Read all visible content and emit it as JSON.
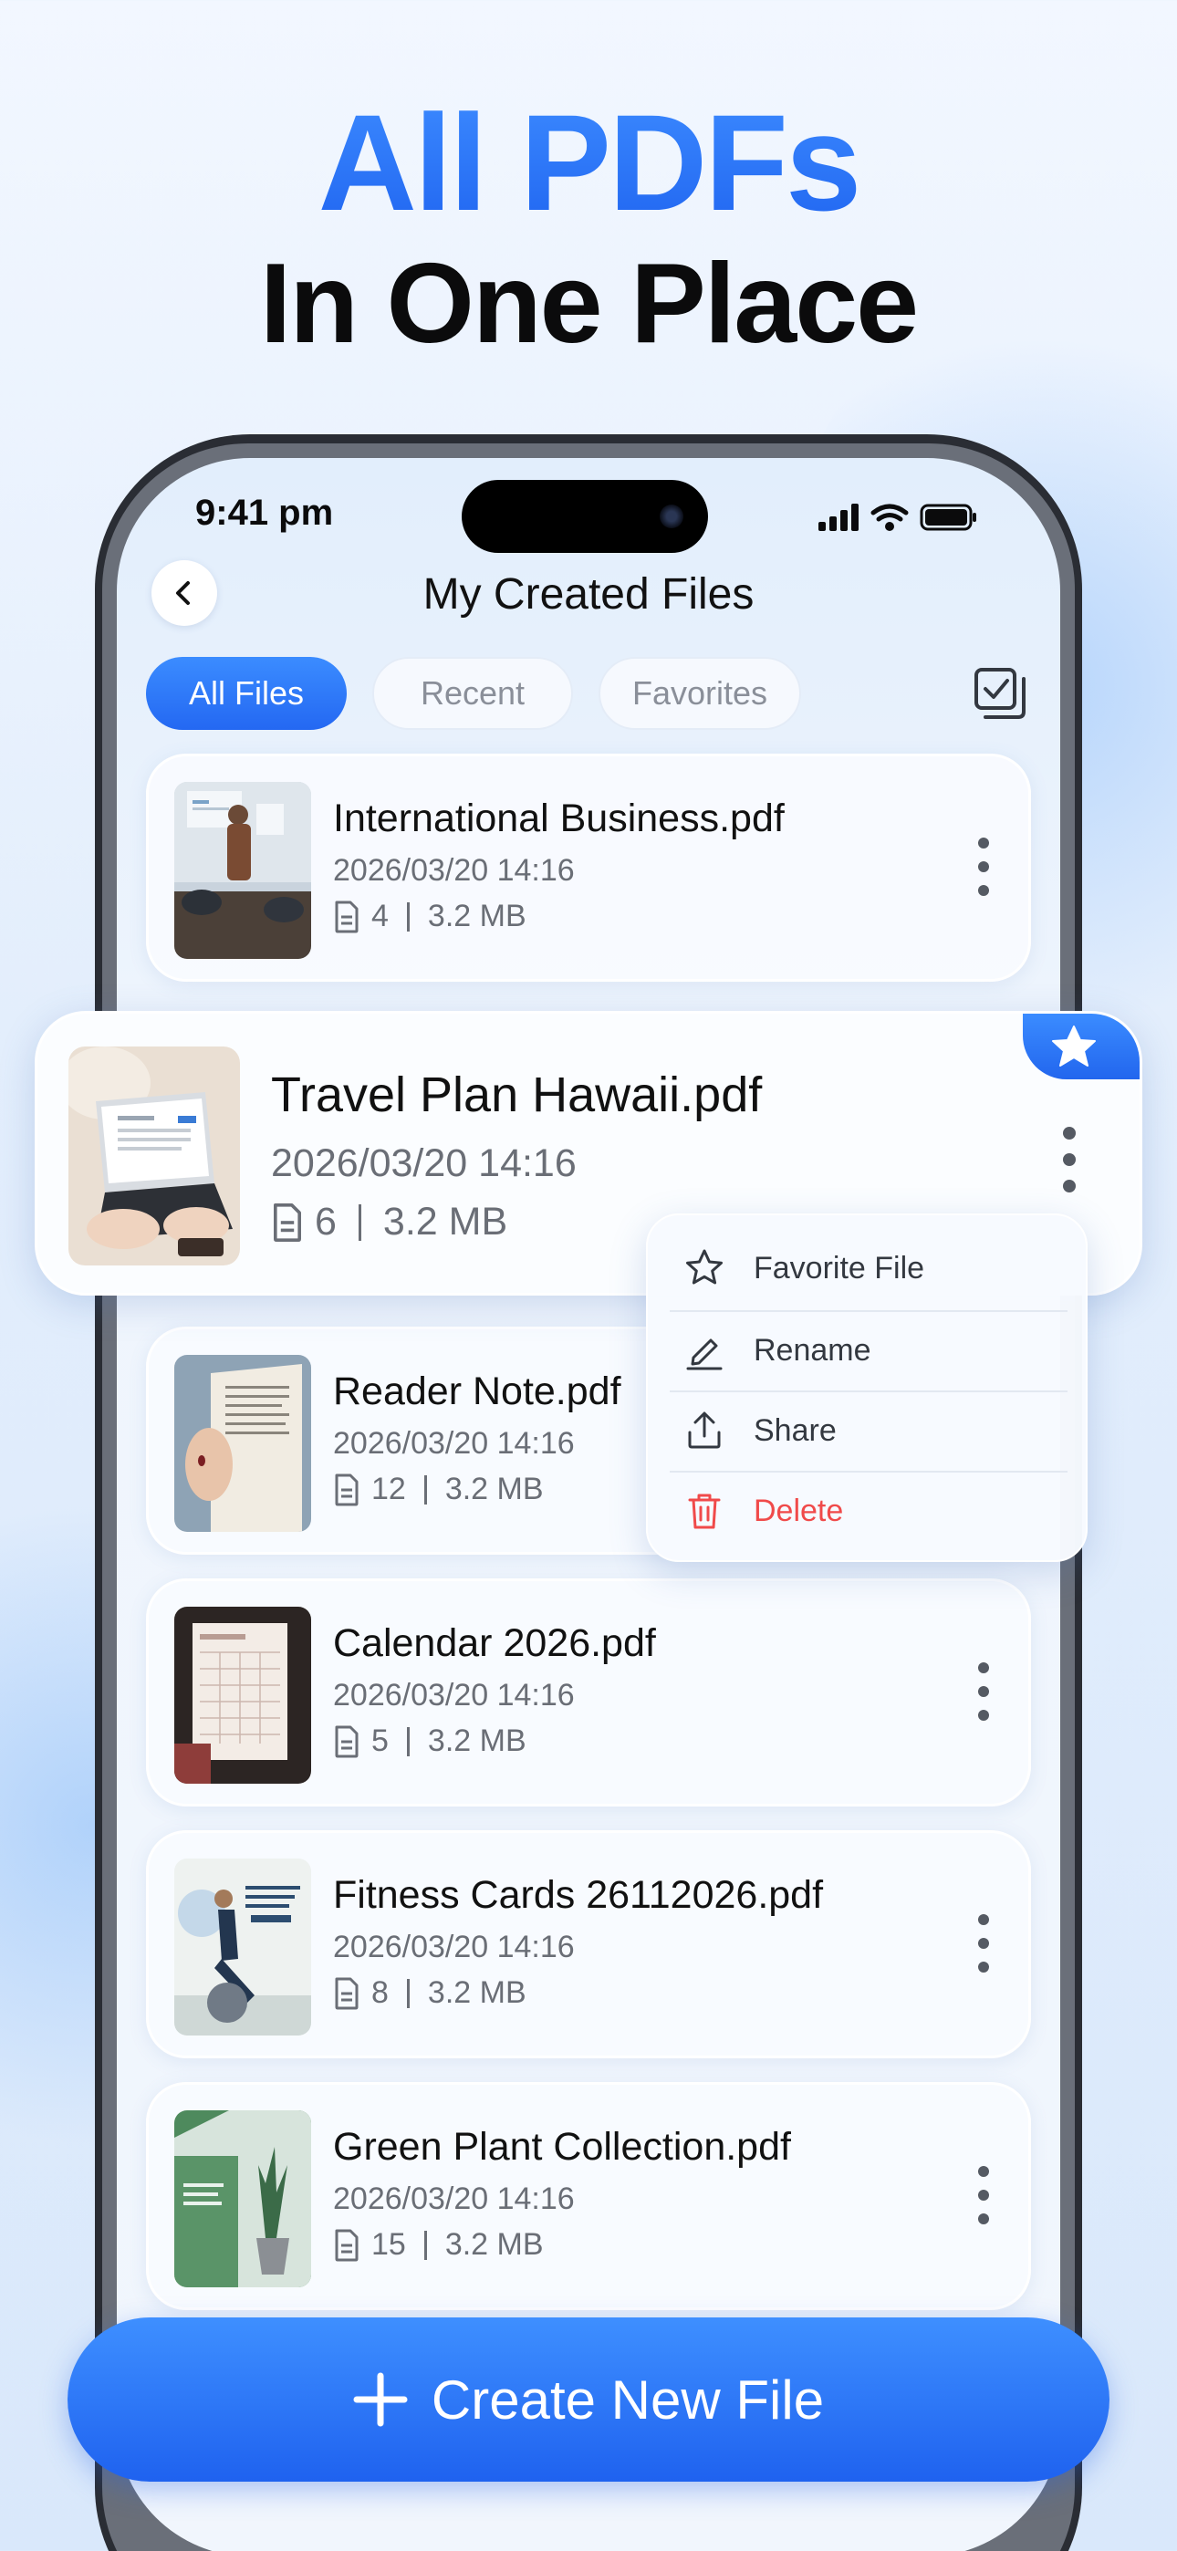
{
  "hero": {
    "line1": "All PDFs",
    "line2": "In One Place"
  },
  "status_bar": {
    "time": "9:41 pm"
  },
  "nav": {
    "title": "My Created Files"
  },
  "tabs": [
    {
      "label": "All Files",
      "active": true
    },
    {
      "label": "Recent",
      "active": false
    },
    {
      "label": "Favorites",
      "active": false
    }
  ],
  "files": [
    {
      "name": "International Business.pdf",
      "date": "2026/03/20  14:16",
      "pages": "4",
      "size": "3.2 MB"
    },
    {
      "name": "Travel Plan Hawaii.pdf",
      "date": "2026/03/20  14:16",
      "pages": "6",
      "size": "3.2 MB",
      "favorite": true
    },
    {
      "name": "Reader Note.pdf",
      "date": "2026/03/20  14:16",
      "pages": "12",
      "size": "3.2 MB"
    },
    {
      "name": "Calendar 2026.pdf",
      "date": "2026/03/20  14:16",
      "pages": "5",
      "size": "3.2 MB"
    },
    {
      "name": "Fitness Cards 26112026.pdf",
      "date": "2026/03/20  14:16",
      "pages": "8",
      "size": "3.2 MB"
    },
    {
      "name": "Green Plant Collection.pdf",
      "date": "2026/03/20  14:16",
      "pages": "15",
      "size": "3.2 MB"
    }
  ],
  "context_menu": {
    "items": [
      {
        "label": "Favorite File",
        "icon": "star-outline-icon"
      },
      {
        "label": "Rename",
        "icon": "pencil-icon"
      },
      {
        "label": "Share",
        "icon": "share-upload-icon"
      },
      {
        "label": "Delete",
        "icon": "trash-icon"
      }
    ]
  },
  "cta": {
    "label": "Create New File"
  },
  "colors": {
    "accent": "#2468f2",
    "danger": "#f04a4a",
    "text": "#111111",
    "muted": "#6a6e76"
  }
}
